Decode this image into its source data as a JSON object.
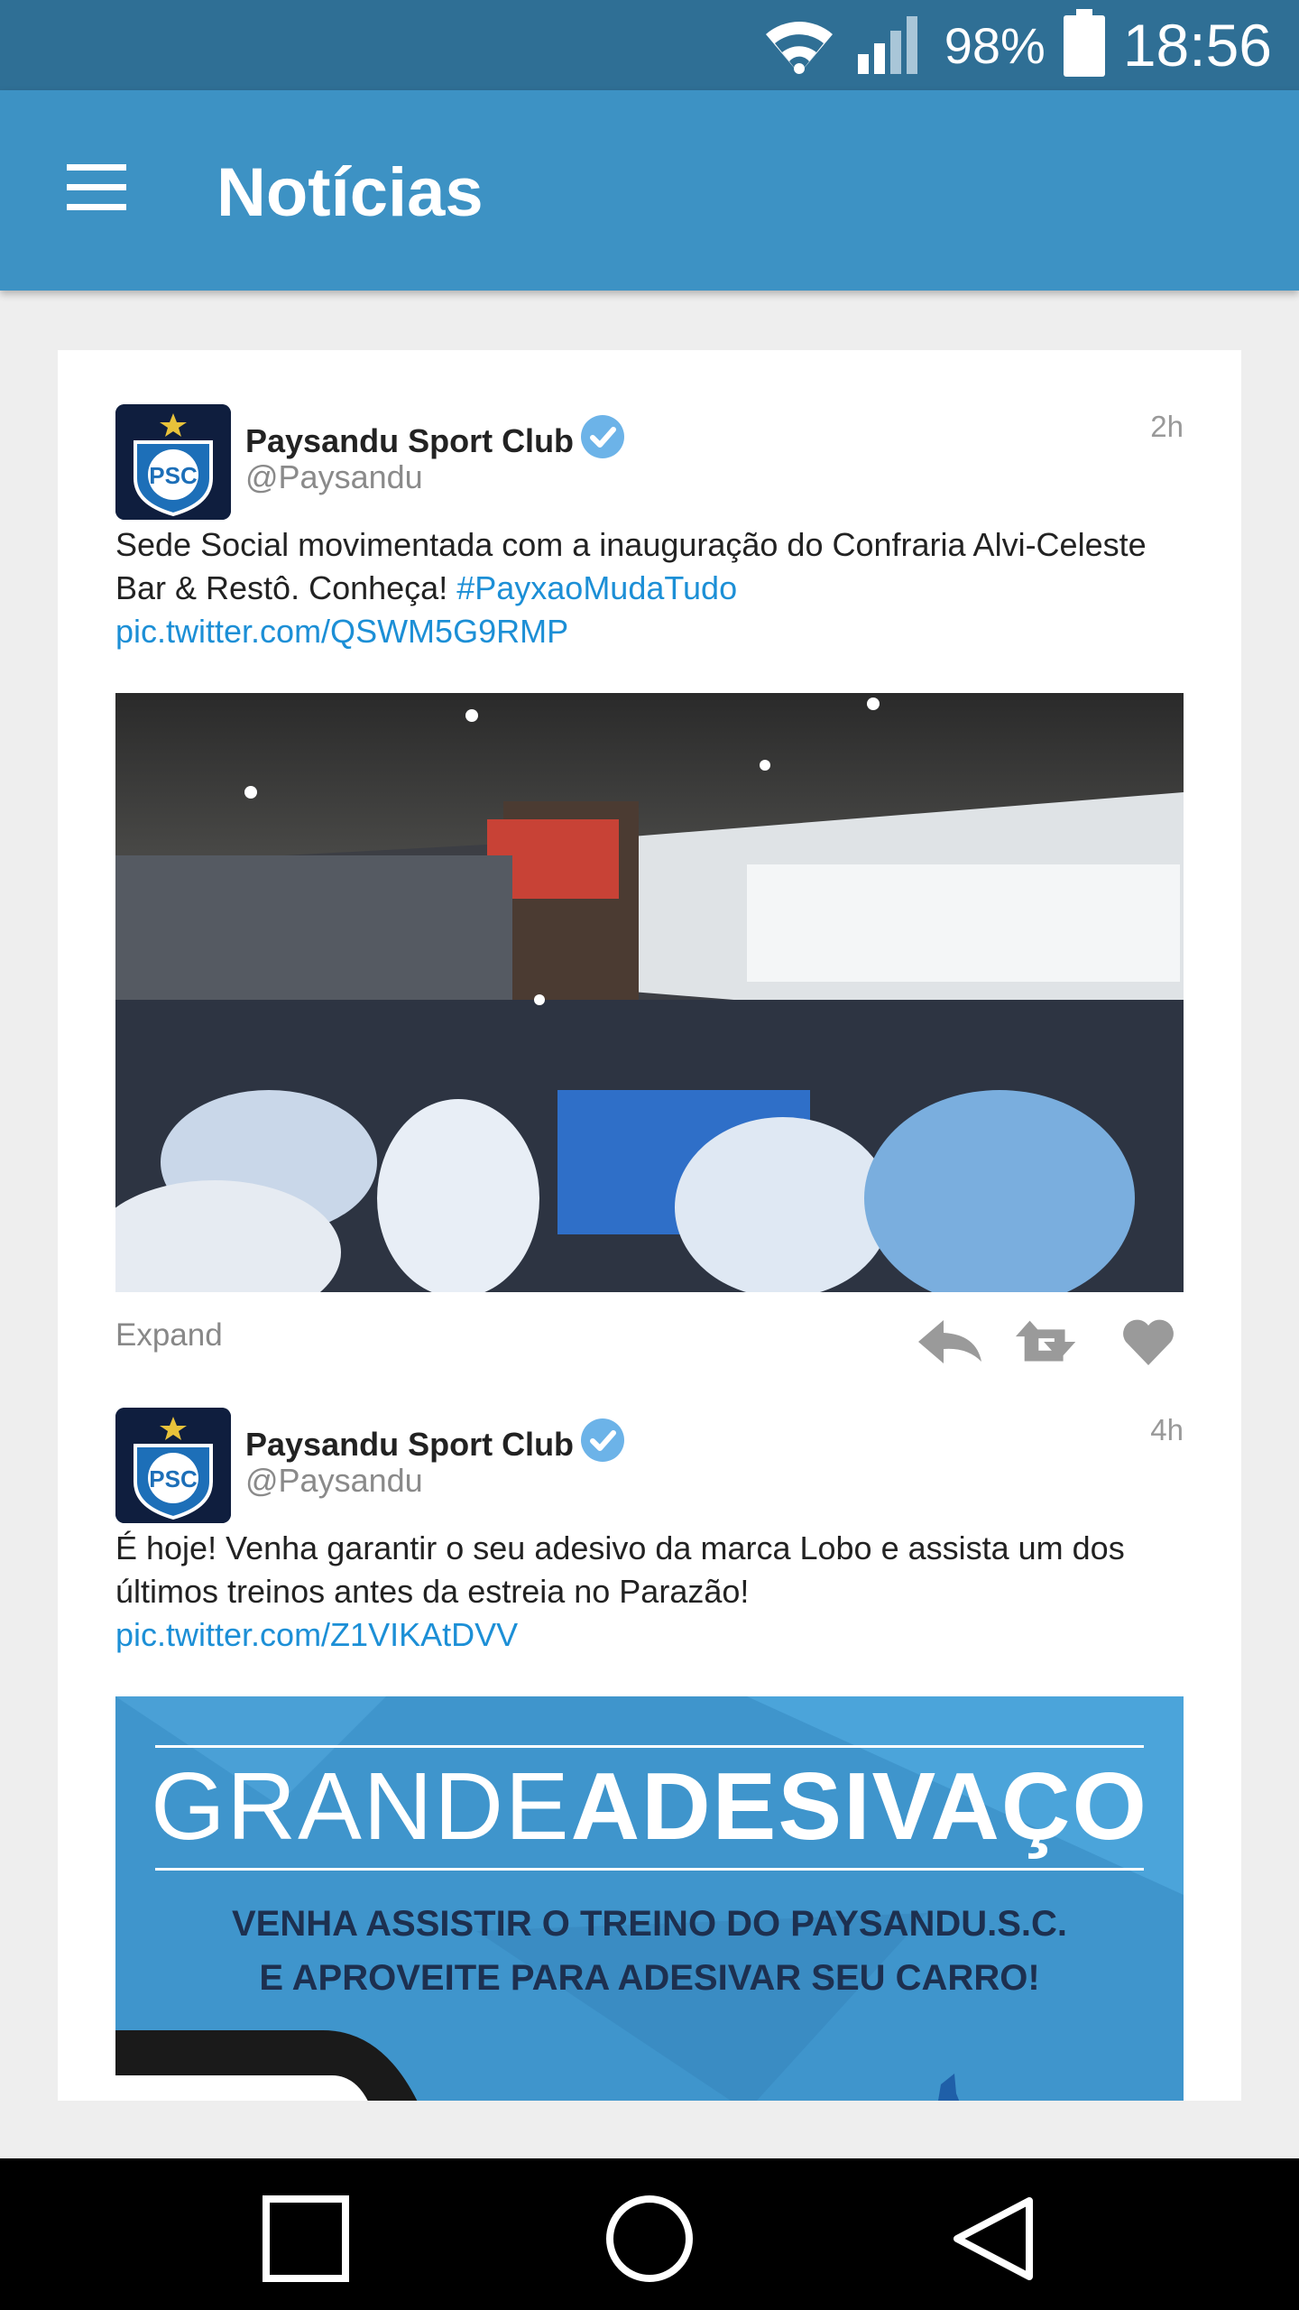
{
  "status_bar": {
    "battery_text": "98%",
    "time": "18:56"
  },
  "app_bar": {
    "title": "Notícias"
  },
  "tweets": [
    {
      "author": "Paysandu Sport Club",
      "handle": "@Paysandu",
      "time": "2h",
      "text": "Sede Social movimentada com a inauguração do Confraria Alvi-Celeste Bar & Restô. Conheça!",
      "hashtag": "#PayxaoMudaTudo",
      "link": "pic.twitter.com/QSWM5G9RMP",
      "expand_label": "Expand"
    },
    {
      "author": "Paysandu Sport Club",
      "handle": "@Paysandu",
      "time": "4h",
      "text": "É hoje! Venha garantir o seu adesivo da marca Lobo e assista um dos últimos treinos antes da estreia no Parazão!",
      "link": "pic.twitter.com/Z1VIKAtDVV",
      "banner": {
        "title_light": "GRANDE",
        "title_bold": "ADESIVAÇO",
        "line1": "VENHA ASSISTIR O TREINO DO PAYSANDU.S.C.",
        "line2": "E APROVEITE PARA ADESIVAR SEU CARRO!"
      }
    }
  ],
  "icons": [
    "wifi-icon",
    "signal-icon",
    "battery-icon",
    "menu-icon",
    "verified-icon",
    "reply-icon",
    "retweet-icon",
    "like-icon",
    "recents-icon",
    "home-icon",
    "back-icon"
  ],
  "colors": {
    "status_bar": "#2f6f95",
    "app_bar": "#3d92c4",
    "link": "#1c8fd6"
  }
}
